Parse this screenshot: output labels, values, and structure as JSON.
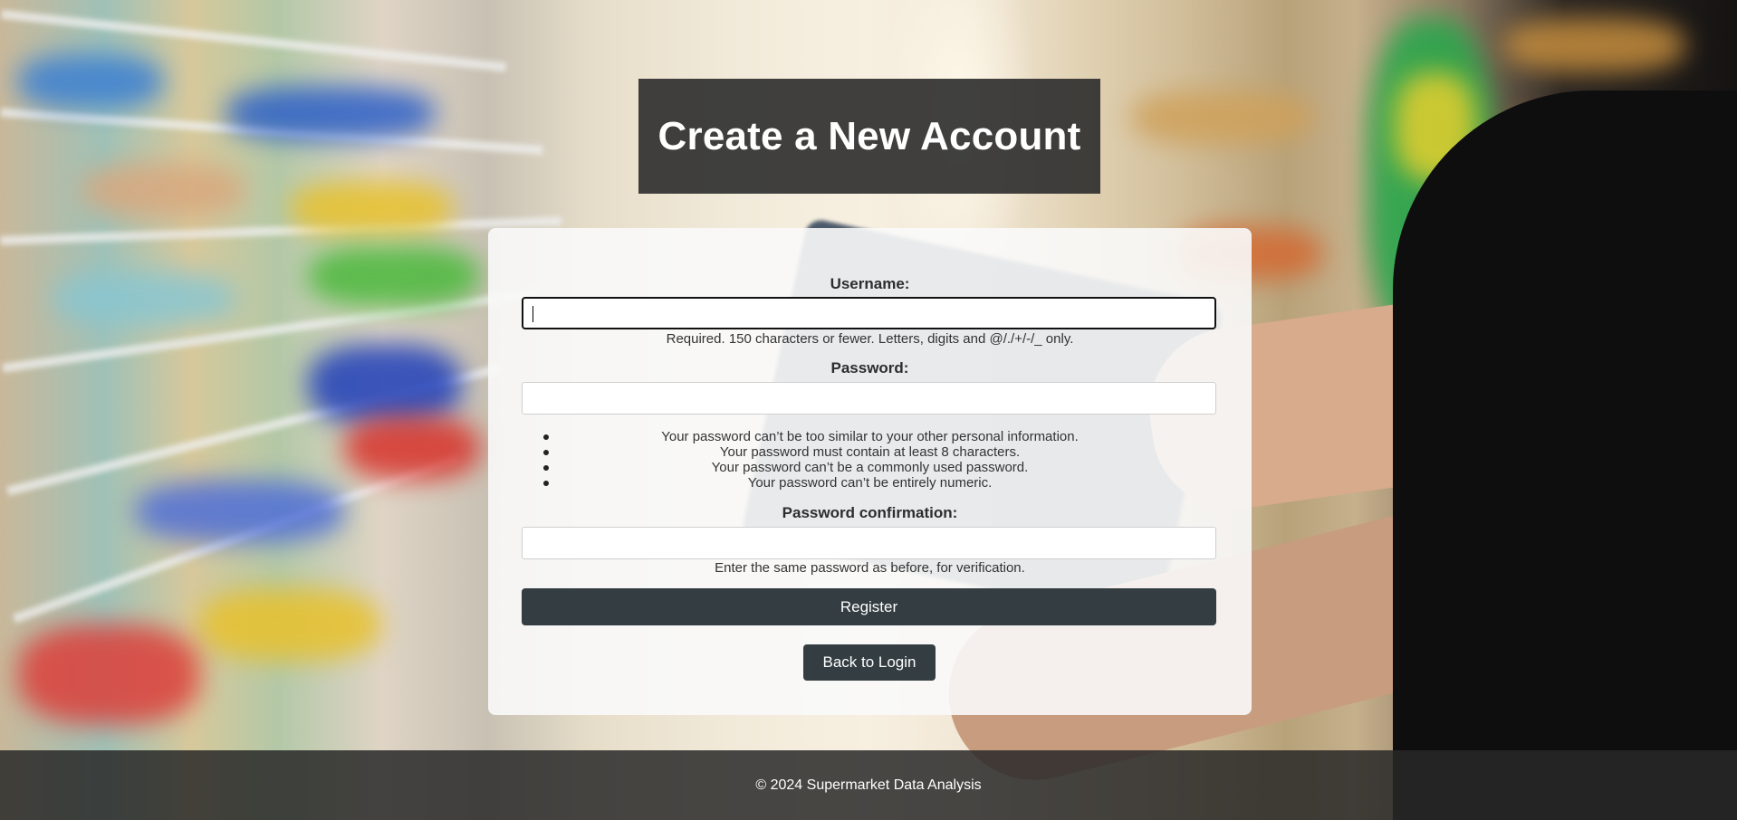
{
  "header": {
    "title": "Create a New Account"
  },
  "form": {
    "username": {
      "label": "Username:",
      "value": "",
      "help": "Required. 150 characters or fewer. Letters, digits and @/./+/-/_ only."
    },
    "password": {
      "label": "Password:",
      "value": "",
      "rules": [
        "Your password can’t be too similar to your other personal information.",
        "Your password must contain at least 8 characters.",
        "Your password can’t be a commonly used password.",
        "Your password can’t be entirely numeric."
      ]
    },
    "password_confirmation": {
      "label": "Password confirmation:",
      "value": "",
      "help": "Enter the same password as before, for verification."
    },
    "register_label": "Register",
    "back_label": "Back to Login"
  },
  "footer": {
    "text": "© 2024 Supermarket Data Analysis"
  }
}
